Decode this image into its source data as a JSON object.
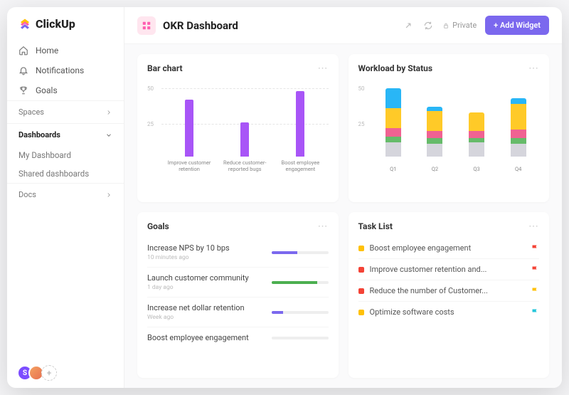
{
  "brand": "ClickUp",
  "sidebar": {
    "nav": [
      {
        "label": "Home",
        "icon": "home"
      },
      {
        "label": "Notifications",
        "icon": "bell"
      },
      {
        "label": "Goals",
        "icon": "trophy"
      }
    ],
    "sections": [
      {
        "label": "Spaces",
        "expanded": false,
        "items": []
      },
      {
        "label": "Dashboards",
        "expanded": true,
        "items": [
          "My Dashboard",
          "Shared dashboards"
        ]
      },
      {
        "label": "Docs",
        "expanded": false,
        "items": []
      }
    ],
    "avatar_initial": "S"
  },
  "header": {
    "title": "OKR Dashboard",
    "private_label": "Private",
    "add_widget_label": "+ Add Widget"
  },
  "cards": {
    "bar_chart": {
      "title": "Bar chart"
    },
    "workload": {
      "title": "Workload by Status"
    },
    "goals": {
      "title": "Goals"
    },
    "tasks": {
      "title": "Task List"
    }
  },
  "goals": [
    {
      "name": "Increase NPS by 10 bps",
      "time": "10 minutes ago",
      "progress": 45,
      "color": "#7b68ee"
    },
    {
      "name": "Launch customer community",
      "time": "1 day ago",
      "progress": 80,
      "color": "#4caf50"
    },
    {
      "name": "Increase net dollar retention",
      "time": "Week ago",
      "progress": 20,
      "color": "#7b68ee"
    },
    {
      "name": "Boost employee engagement",
      "time": "",
      "progress": 0,
      "color": "#ccc"
    }
  ],
  "tasks": [
    {
      "name": "Boost employee engagement",
      "dot": "#ffc107",
      "flag": "#f44336"
    },
    {
      "name": "Improve customer retention and...",
      "dot": "#f44336",
      "flag": "#f44336"
    },
    {
      "name": "Reduce the number of Customer...",
      "dot": "#f44336",
      "flag": "#ffc107"
    },
    {
      "name": "Optimize software costs",
      "dot": "#ffc107",
      "flag": "#26c6da"
    }
  ],
  "chart_data": [
    {
      "type": "bar",
      "title": "Bar chart",
      "categories": [
        "Improve customer retention",
        "Reduce customer-reported bugs",
        "Boost employee engagement"
      ],
      "values": [
        40,
        24,
        46
      ],
      "ylim": [
        0,
        50
      ],
      "yticks": [
        25,
        50
      ],
      "color": "#a855f7"
    },
    {
      "type": "stacked-bar",
      "title": "Workload by Status",
      "categories": [
        "Q1",
        "Q2",
        "Q3",
        "Q4"
      ],
      "ylim": [
        0,
        50
      ],
      "yticks": [
        25,
        50
      ],
      "series": [
        {
          "name": "grey",
          "color": "#d5d5dc",
          "values": [
            10,
            9,
            10,
            9
          ]
        },
        {
          "name": "green",
          "color": "#66bb6a",
          "values": [
            4,
            4,
            3,
            4
          ]
        },
        {
          "name": "pink",
          "color": "#f06292",
          "values": [
            6,
            5,
            5,
            6
          ]
        },
        {
          "name": "yellow",
          "color": "#ffca28",
          "values": [
            14,
            14,
            13,
            18
          ]
        },
        {
          "name": "blue",
          "color": "#29b6f6",
          "values": [
            14,
            3,
            0,
            4
          ]
        }
      ]
    }
  ]
}
